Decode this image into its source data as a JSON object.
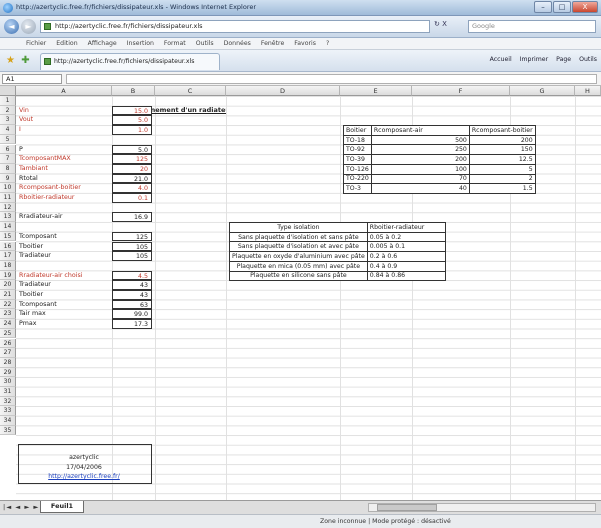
{
  "window": {
    "title": "http://azertyclic.free.fr/fichiers/dissipateur.xls - Windows Internet Explorer",
    "controls": [
      "–",
      "□",
      "X"
    ]
  },
  "address": {
    "url": "http://azertyclic.free.fr/fichiers/dissipateur.xls",
    "refresh": "↻",
    "stop": "X",
    "search_placeholder": "Google"
  },
  "menu": [
    "Fichier",
    "Edition",
    "Affichage",
    "Insertion",
    "Format",
    "Outils",
    "Données",
    "Fenêtre",
    "Favoris",
    "?"
  ],
  "favbar": {
    "tab_title": "http://azertyclic.free.fr/fichiers/dissipateur.xls",
    "commands": [
      "Accueil",
      "Imprimer",
      "Page",
      "Outils"
    ]
  },
  "formula": {
    "namebox": "A1",
    "content": ""
  },
  "columns": [
    "A",
    "B",
    "C",
    "D",
    "E",
    "F",
    "G",
    "H"
  ],
  "rows": [
    "1",
    "2",
    "3",
    "4",
    "5",
    "6",
    "7",
    "8",
    "9",
    "10",
    "11",
    "12",
    "13",
    "14",
    "15",
    "16",
    "17",
    "18",
    "19",
    "20",
    "21",
    "22",
    "23",
    "24",
    "25",
    "26",
    "27",
    "28",
    "29",
    "30",
    "31",
    "32",
    "33",
    "34",
    "35"
  ],
  "sheet": {
    "title": "Dimensionnement d'un radiateur",
    "inputs": [
      {
        "row": 2,
        "label": "Vin",
        "value": "15.0",
        "red": true
      },
      {
        "row": 3,
        "label": "Vout",
        "value": "5.0",
        "red": true
      },
      {
        "row": 4,
        "label": "I",
        "value": "1.0",
        "red": true
      },
      {
        "row": 6,
        "label": "P",
        "value": "5.0",
        "red": false
      },
      {
        "row": 7,
        "label": "TcomposantMAX",
        "value": "125",
        "red": true
      },
      {
        "row": 8,
        "label": "Tambiant",
        "value": "20",
        "red": true
      },
      {
        "row": 9,
        "label": "Rtotal",
        "value": "21.0",
        "red": false
      },
      {
        "row": 10,
        "label": "Rcomposant-boitier",
        "value": "4.0",
        "red": true
      },
      {
        "row": 11,
        "label": "Rboitier-radiateur",
        "value": "0.1",
        "red": true
      },
      {
        "row": 13,
        "label": "Rradiateur-air",
        "value": "16.9",
        "red": false
      },
      {
        "row": 15,
        "label": "Tcomposant",
        "value": "125",
        "red": false
      },
      {
        "row": 16,
        "label": "Tboitier",
        "value": "105",
        "red": false
      },
      {
        "row": 17,
        "label": "Tradiateur",
        "value": "105",
        "red": false
      },
      {
        "row": 19,
        "label": "Rradiateur-air choisi",
        "value": "4.5",
        "red": true
      },
      {
        "row": 20,
        "label": "Tradiateur",
        "value": "43",
        "red": false
      },
      {
        "row": 21,
        "label": "Tboitier",
        "value": "43",
        "red": false
      },
      {
        "row": 22,
        "label": "Tcomposant",
        "value": "63",
        "red": false
      },
      {
        "row": 23,
        "label": "Tair max",
        "value": "99.0",
        "red": false
      },
      {
        "row": 24,
        "label": "Pmax",
        "value": "17.3",
        "red": false
      }
    ],
    "package_table": {
      "headers": [
        "Boitier",
        "Rcomposant-air",
        "Rcomposant-boitier"
      ],
      "rows": [
        [
          "TO-18",
          "500",
          "200"
        ],
        [
          "TO-92",
          "250",
          "150"
        ],
        [
          "TO-39",
          "200",
          "12.5"
        ],
        [
          "TO-126",
          "100",
          "5"
        ],
        [
          "TO-220",
          "70",
          "2"
        ],
        [
          "TO-3",
          "40",
          "1.5"
        ]
      ]
    },
    "isolation_table": {
      "headers": [
        "Type isolation",
        "Rboitier-radiateur"
      ],
      "rows": [
        [
          "Sans plaquette d'isolation et sans pâte",
          "0.05 à 0.2"
        ],
        [
          "Sans plaquette d'isolation et avec pâte",
          "0.005 à 0.1"
        ],
        [
          "Plaquette en oxyde d'aluminium avec pâte",
          "0.2 à 0.6"
        ],
        [
          "Plaquette en mica (0.05 mm) avec pâte",
          "0.4 à 0.9"
        ],
        [
          "Plaquette en silicone sans pâte",
          "0.84 à 0.86"
        ]
      ]
    },
    "credit": {
      "author": "azertyclic",
      "date": "17/04/2006",
      "url": "http://azertyclic.free.fr/"
    }
  },
  "sheet_tabs": {
    "nav": "|◄ ◄ ► ►|",
    "active": "Feuil1"
  },
  "status": {
    "text": "Zone inconnue | Mode protégé : désactivé"
  }
}
